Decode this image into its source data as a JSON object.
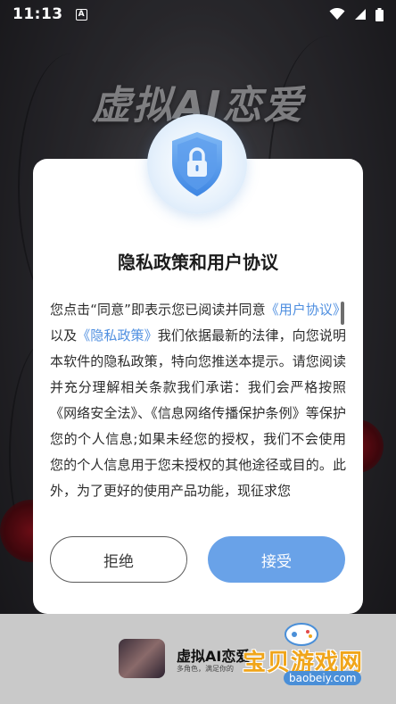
{
  "status_bar": {
    "time": "11:13",
    "notification_icon": "A"
  },
  "background": {
    "app_title": "虚拟AI恋爱"
  },
  "dialog": {
    "title": "隐私政策和用户协议",
    "body": {
      "p1": "您点击“同意”即表示您已阅读并同意",
      "link_user_agreement": "《用户协议》",
      "p2": "以及",
      "link_privacy_policy": "《隐私政策》",
      "p3": "我们依据最新的法律，向您说明本软件的隐私政策，特向您推送本提示。请您阅读并充分理解相关条款我们承诺：我们会严格按照《网络安全法》、《信息网络传播保护条例》等保护您的个人信息;如果未经您的授权，我们不会使用您的个人信息用于您未授权的其他途径或目的。此外，为了更好的使用产品功能，现征求您"
    },
    "reject_label": "拒绝",
    "accept_label": "接受"
  },
  "bottom_bar": {
    "app_name": "虚拟AI恋爱",
    "subtitle": "多角色，满足你的"
  },
  "watermark": {
    "text": "宝贝游戏网",
    "url": "baobeiy.com"
  },
  "colors": {
    "accent": "#69a2e8",
    "link": "#4f8fe0",
    "watermark": "#f0a51a"
  }
}
